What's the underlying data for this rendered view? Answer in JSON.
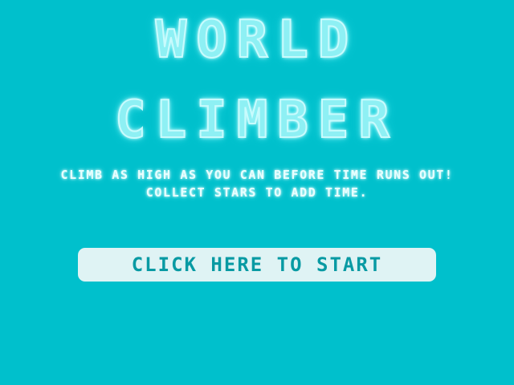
{
  "title": {
    "line1": "WORLD",
    "line2": "CLiMBER"
  },
  "instructions": {
    "line1": "CLIMB AS HIGH AS YOU CAN BEFORE TIME RUNS OUT!",
    "line2": "COLLECT STARS TO ADD TIME."
  },
  "start_button": {
    "label": "CLiCK HERE TO START"
  },
  "colors": {
    "background": "#00c0cc",
    "title": "#8ef0f4",
    "button_bg": "#dff3f4",
    "button_text": "#089aa3"
  }
}
